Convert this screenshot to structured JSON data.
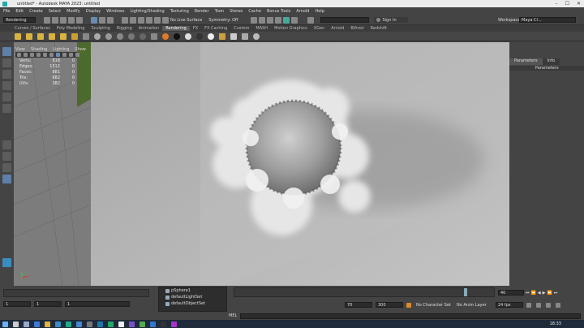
{
  "window": {
    "title": "untitled* - Autodesk MAYA 2023: untitled"
  },
  "menu": [
    "File",
    "Edit",
    "Create",
    "Select",
    "Modify",
    "Display",
    "Windows",
    "Lighting/Shading",
    "Texturing",
    "Render",
    "Toon",
    "Stereo",
    "Cache",
    "Bonus Tools",
    "Arnold",
    "Help"
  ],
  "toolbar": {
    "mode": "Rendering",
    "live_surface": "No Live Surface",
    "symmetry": "Symmetry: Off",
    "sign_in": "Sign In",
    "workspace_label": "Workspace:",
    "workspace_value": "Maya Cl..."
  },
  "shelf_tabs": [
    {
      "label": "Curves / Surfaces",
      "active": false
    },
    {
      "label": "Poly Modeling",
      "active": false
    },
    {
      "label": "Sculpting",
      "active": false
    },
    {
      "label": "Rigging",
      "active": false
    },
    {
      "label": "Animation",
      "active": false
    },
    {
      "label": "Rendering",
      "active": true
    },
    {
      "label": "FX",
      "active": false
    },
    {
      "label": "FX Caching",
      "active": false
    },
    {
      "label": "Custom",
      "active": false
    },
    {
      "label": "MASH",
      "active": false
    },
    {
      "label": "Motion Graphics",
      "active": false
    },
    {
      "label": "XGen",
      "active": false
    },
    {
      "label": "Arnold",
      "active": false
    },
    {
      "label": "Bifrost",
      "active": false
    },
    {
      "label": "Redshift",
      "active": false
    }
  ],
  "viewport": {
    "menu": [
      "View",
      "Shading",
      "Lighting",
      "Show"
    ],
    "hud": [
      {
        "key": "Verts:",
        "value": "818",
        "sel": "0"
      },
      {
        "key": "Edges:",
        "value": "1512",
        "sel": "0"
      },
      {
        "key": "Faces:",
        "value": "881",
        "sel": "0"
      },
      {
        "key": "Tris:",
        "value": "682",
        "sel": "0"
      },
      {
        "key": "UVs:",
        "value": "382",
        "sel": "0"
      }
    ]
  },
  "right_panel": {
    "tabs": [
      "Parameters",
      "Info"
    ],
    "sub": "Parameters"
  },
  "timeline": {
    "start": "1",
    "start2": "1",
    "range_start": "1",
    "range_end": "120",
    "current_frame": "40",
    "end1": "70",
    "end2": "300",
    "character_set": "No Character Set",
    "anim_layer": "No Anim Layer",
    "fps": "24 fps"
  },
  "outliner": [
    "pSphere1",
    "defaultLightSet",
    "defaultObjectSet"
  ],
  "command_line": {
    "label": "MEL"
  },
  "taskbar": {
    "time": "18:33"
  }
}
